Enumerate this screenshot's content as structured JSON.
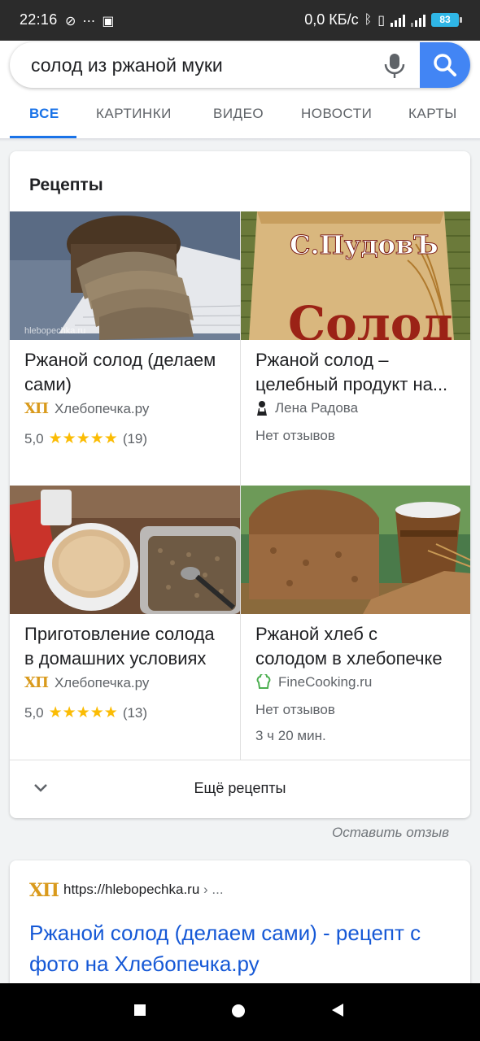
{
  "status_bar": {
    "time": "22:16",
    "net_speed": "0,0 КБ/с",
    "battery": "83"
  },
  "search": {
    "query": "солод из ржаной муки"
  },
  "tabs": [
    {
      "label": "ВСЕ",
      "active": true
    },
    {
      "label": "КАРТИНКИ",
      "active": false
    },
    {
      "label": "ВИДЕО",
      "active": false
    },
    {
      "label": "НОВОСТИ",
      "active": false
    },
    {
      "label": "КАРТЫ",
      "active": false
    }
  ],
  "recipes": {
    "title": "Рецепты",
    "items": [
      {
        "title_line1": "Ржаной солод (делаем",
        "title_line2": "сами)",
        "source": "Хлебопечка.ру",
        "source_icon": "ХП",
        "rating": "5,0",
        "stars": "★★★★★",
        "reviews": "(19)",
        "image_watermark": "hlebopechka.ru"
      },
      {
        "title_line1": "Ржаной солод –",
        "title_line2": "целебный продукт на...",
        "source": "Лена Радова",
        "no_reviews": "Нет отзывов",
        "image_brand": "С.ПудовЪ",
        "image_text": "Солод"
      },
      {
        "title_line1": "Приготовление солода",
        "title_line2": "в домашних условиях",
        "source": "Хлебопечка.ру",
        "source_icon": "ХП",
        "rating": "5,0",
        "stars": "★★★★★",
        "reviews": "(13)"
      },
      {
        "title_line1": "Ржаной хлеб с",
        "title_line2": "солодом в хлебопечке",
        "source": "FineCooking.ru",
        "no_reviews": "Нет отзывов",
        "time": "3 ч 20 мин."
      }
    ],
    "more_label": "Ещё рецепты"
  },
  "feedback_label": "Оставить отзыв",
  "result": {
    "favicon": "ХП",
    "url_main": "https://hlebopechka.ru",
    "url_rest": " › ...",
    "title_line1": "Ржаной солод (делаем сами) - рецепт с",
    "title_line2": "фото на Хлебопечка.ру"
  },
  "colors": {
    "accent": "#1a73e8",
    "search_button": "#4285f4",
    "stars": "#fbbc04",
    "link": "#1558d6"
  }
}
